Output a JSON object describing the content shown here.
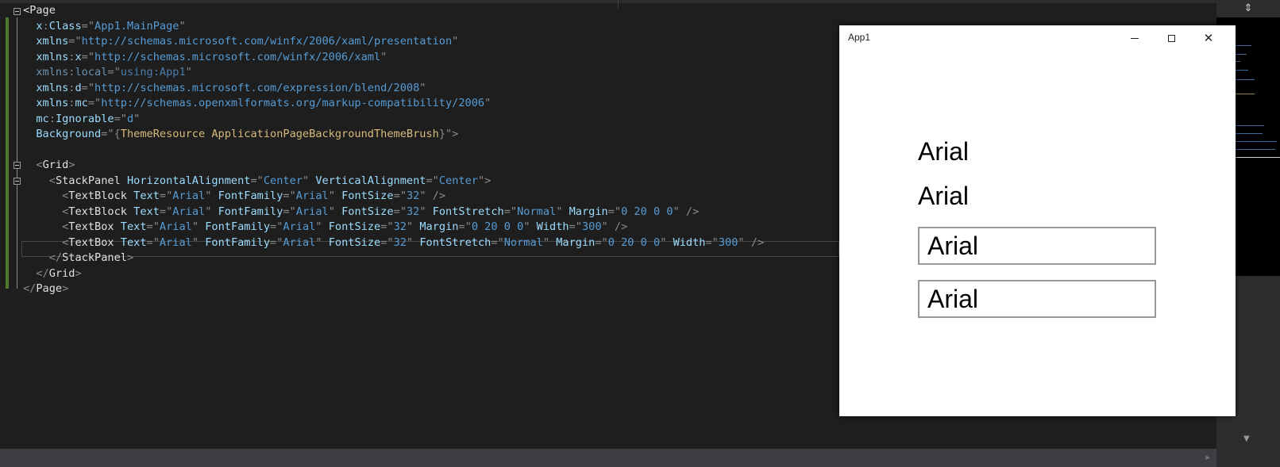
{
  "editor": {
    "lines": [
      [
        [
          "tag",
          "<"
        ],
        [
          "tag",
          "Page"
        ]
      ],
      [
        [
          "ind",
          "  "
        ],
        [
          "att",
          "x"
        ],
        [
          "pun",
          ":"
        ],
        [
          "att",
          "Class"
        ],
        [
          "pun",
          "=\""
        ],
        [
          "val",
          "App1.MainPage"
        ],
        [
          "pun",
          "\""
        ]
      ],
      [
        [
          "ind",
          "  "
        ],
        [
          "att",
          "xmlns"
        ],
        [
          "pun",
          "=\""
        ],
        [
          "val",
          "http://schemas.microsoft.com/winfx/2006/xaml/presentation"
        ],
        [
          "pun",
          "\""
        ]
      ],
      [
        [
          "ind",
          "  "
        ],
        [
          "att",
          "xmlns"
        ],
        [
          "pun",
          ":"
        ],
        [
          "att",
          "x"
        ],
        [
          "pun",
          "=\""
        ],
        [
          "val",
          "http://schemas.microsoft.com/winfx/2006/xaml"
        ],
        [
          "pun",
          "\""
        ]
      ],
      [
        [
          "ind",
          "  "
        ],
        [
          "dim-att",
          "xmlns"
        ],
        [
          "pun",
          ":"
        ],
        [
          "dim-att",
          "local"
        ],
        [
          "pun",
          "=\""
        ],
        [
          "dim-val",
          "using:App1"
        ],
        [
          "pun",
          "\""
        ]
      ],
      [
        [
          "ind",
          "  "
        ],
        [
          "att",
          "xmlns"
        ],
        [
          "pun",
          ":"
        ],
        [
          "att",
          "d"
        ],
        [
          "pun",
          "=\""
        ],
        [
          "val",
          "http://schemas.microsoft.com/expression/blend/2008"
        ],
        [
          "pun",
          "\""
        ]
      ],
      [
        [
          "ind",
          "  "
        ],
        [
          "att",
          "xmlns"
        ],
        [
          "pun",
          ":"
        ],
        [
          "att",
          "mc"
        ],
        [
          "pun",
          "=\""
        ],
        [
          "val",
          "http://schemas.openxmlformats.org/markup-compatibility/2006"
        ],
        [
          "pun",
          "\""
        ]
      ],
      [
        [
          "ind",
          "  "
        ],
        [
          "att",
          "mc"
        ],
        [
          "pun",
          ":"
        ],
        [
          "att",
          "Ignorable"
        ],
        [
          "pun",
          "=\""
        ],
        [
          "val",
          "d"
        ],
        [
          "pun",
          "\""
        ]
      ],
      [
        [
          "ind",
          "  "
        ],
        [
          "att",
          "Background"
        ],
        [
          "pun",
          "=\""
        ],
        [
          "pun",
          "{"
        ],
        [
          "res",
          "ThemeResource ApplicationPageBackgroundThemeBrush"
        ],
        [
          "pun",
          "}\">"
        ]
      ],
      [],
      [
        [
          "ind",
          "  "
        ],
        [
          "pun",
          "<"
        ],
        [
          "tag",
          "Grid"
        ],
        [
          "pun",
          ">"
        ]
      ],
      [
        [
          "ind",
          "    "
        ],
        [
          "pun",
          "<"
        ],
        [
          "tag",
          "StackPanel "
        ],
        [
          "att",
          "HorizontalAlignment"
        ],
        [
          "pun",
          "=\""
        ],
        [
          "val",
          "Center"
        ],
        [
          "pun",
          "\" "
        ],
        [
          "att",
          "VerticalAlignment"
        ],
        [
          "pun",
          "=\""
        ],
        [
          "val",
          "Center"
        ],
        [
          "pun",
          "\">"
        ]
      ],
      [
        [
          "ind",
          "      "
        ],
        [
          "pun",
          "<"
        ],
        [
          "tag",
          "TextBlock "
        ],
        [
          "att",
          "Text"
        ],
        [
          "pun",
          "=\""
        ],
        [
          "val",
          "Arial"
        ],
        [
          "pun",
          "\" "
        ],
        [
          "att",
          "FontFamily"
        ],
        [
          "pun",
          "=\""
        ],
        [
          "val",
          "Arial"
        ],
        [
          "pun",
          "\" "
        ],
        [
          "att",
          "FontSize"
        ],
        [
          "pun",
          "=\""
        ],
        [
          "val",
          "32"
        ],
        [
          "pun",
          "\" />"
        ]
      ],
      [
        [
          "ind",
          "      "
        ],
        [
          "pun",
          "<"
        ],
        [
          "tag",
          "TextBlock "
        ],
        [
          "att",
          "Text"
        ],
        [
          "pun",
          "=\""
        ],
        [
          "val",
          "Arial"
        ],
        [
          "pun",
          "\" "
        ],
        [
          "att",
          "FontFamily"
        ],
        [
          "pun",
          "=\""
        ],
        [
          "val",
          "Arial"
        ],
        [
          "pun",
          "\" "
        ],
        [
          "att",
          "FontSize"
        ],
        [
          "pun",
          "=\""
        ],
        [
          "val",
          "32"
        ],
        [
          "pun",
          "\" "
        ],
        [
          "att",
          "FontStretch"
        ],
        [
          "pun",
          "=\""
        ],
        [
          "val",
          "Normal"
        ],
        [
          "pun",
          "\" "
        ],
        [
          "att",
          "Margin"
        ],
        [
          "pun",
          "=\""
        ],
        [
          "val",
          "0 20 0 0"
        ],
        [
          "pun",
          "\" />"
        ]
      ],
      [
        [
          "ind",
          "      "
        ],
        [
          "pun",
          "<"
        ],
        [
          "tag",
          "TextBox "
        ],
        [
          "att",
          "Text"
        ],
        [
          "pun",
          "=\""
        ],
        [
          "val",
          "Arial"
        ],
        [
          "pun",
          "\" "
        ],
        [
          "att",
          "FontFamily"
        ],
        [
          "pun",
          "=\""
        ],
        [
          "val",
          "Arial"
        ],
        [
          "pun",
          "\" "
        ],
        [
          "att",
          "FontSize"
        ],
        [
          "pun",
          "=\""
        ],
        [
          "val",
          "32"
        ],
        [
          "pun",
          "\" "
        ],
        [
          "att",
          "Margin"
        ],
        [
          "pun",
          "=\""
        ],
        [
          "val",
          "0 20 0 0"
        ],
        [
          "pun",
          "\" "
        ],
        [
          "att",
          "Width"
        ],
        [
          "pun",
          "=\""
        ],
        [
          "val",
          "300"
        ],
        [
          "pun",
          "\" />"
        ]
      ],
      [
        [
          "ind",
          "      "
        ],
        [
          "pun",
          "<"
        ],
        [
          "tag",
          "TextBox "
        ],
        [
          "att",
          "Text"
        ],
        [
          "pun",
          "=\""
        ],
        [
          "val",
          "Arial"
        ],
        [
          "pun",
          "\" "
        ],
        [
          "att",
          "FontFamily"
        ],
        [
          "pun",
          "=\""
        ],
        [
          "val",
          "Arial"
        ],
        [
          "pun",
          "\" "
        ],
        [
          "att",
          "FontSize"
        ],
        [
          "pun",
          "=\""
        ],
        [
          "val",
          "32"
        ],
        [
          "pun",
          "\" "
        ],
        [
          "att",
          "FontStretch"
        ],
        [
          "pun",
          "=\""
        ],
        [
          "val",
          "Normal"
        ],
        [
          "pun",
          "\" "
        ],
        [
          "att",
          "Margin"
        ],
        [
          "pun",
          "=\""
        ],
        [
          "val",
          "0 20 0 0"
        ],
        [
          "pun",
          "\" "
        ],
        [
          "att",
          "Width"
        ],
        [
          "pun",
          "=\""
        ],
        [
          "val",
          "300"
        ],
        [
          "pun",
          "\" />"
        ]
      ],
      [
        [
          "ind",
          "    "
        ],
        [
          "pun",
          "</"
        ],
        [
          "tag",
          "StackPanel"
        ],
        [
          "pun",
          ">"
        ]
      ],
      [
        [
          "ind",
          "  "
        ],
        [
          "pun",
          "</"
        ],
        [
          "tag",
          "Grid"
        ],
        [
          "pun",
          ">"
        ]
      ],
      [
        [
          "pun",
          "</"
        ],
        [
          "tag",
          "Page"
        ],
        [
          "pun",
          ">"
        ]
      ]
    ]
  },
  "app": {
    "title": "App1",
    "textblock1": "Arial",
    "textblock2": "Arial",
    "textbox1_value": "Arial",
    "textbox2_value": "Arial",
    "min_icon": "minimize-icon",
    "max_icon": "maximize-icon",
    "close_icon": "close-icon",
    "close_glyph": "✕"
  },
  "minimap": {
    "split_glyph": "⇕",
    "down_glyph": "▼"
  },
  "scroll": {
    "right_glyph": "▸"
  },
  "colors": {
    "tag": "#e0e0e0",
    "attribute": "#9cdcfe",
    "value": "#569cd6",
    "resource": "#d7ba7d",
    "change_bar": "#4e7a2b"
  }
}
